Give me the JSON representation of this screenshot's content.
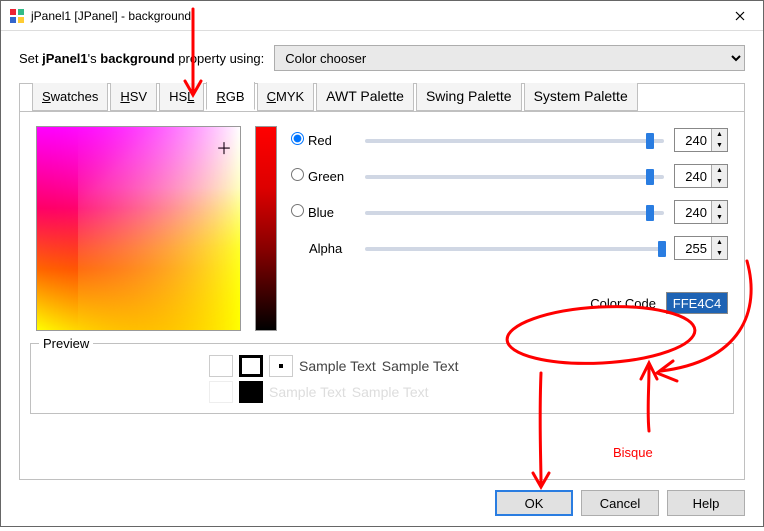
{
  "window": {
    "title": "jPanel1 [JPanel] - background"
  },
  "header": {
    "label_pre": "Set ",
    "label_obj": "jPanel1",
    "label_mid": "'s ",
    "label_prop": "background",
    "label_post": " property using:",
    "dropdown_value": "Color chooser"
  },
  "tabs": [
    "Swatches",
    "HSV",
    "HSL",
    "RGB",
    "CMYK",
    "AWT Palette",
    "Swing Palette",
    "System Palette"
  ],
  "active_tab_index": 3,
  "channels": {
    "red": {
      "label": "Red",
      "value": 240,
      "pos": 0.94
    },
    "green": {
      "label": "Green",
      "value": 240,
      "pos": 0.94
    },
    "blue": {
      "label": "Blue",
      "value": 240,
      "pos": 0.94
    },
    "alpha": {
      "label": "Alpha",
      "value": 255,
      "pos": 1.0
    }
  },
  "color_code": {
    "label": "Color Code",
    "value": "FFE4C4"
  },
  "preview": {
    "label": "Preview",
    "sample1": "Sample Text",
    "sample2": "Sample Text",
    "sample3": "Sample Text",
    "sample4": "Sample Text"
  },
  "buttons": {
    "ok": "OK",
    "cancel": "Cancel",
    "help": "Help"
  },
  "annotation": {
    "word": "Bisque"
  }
}
